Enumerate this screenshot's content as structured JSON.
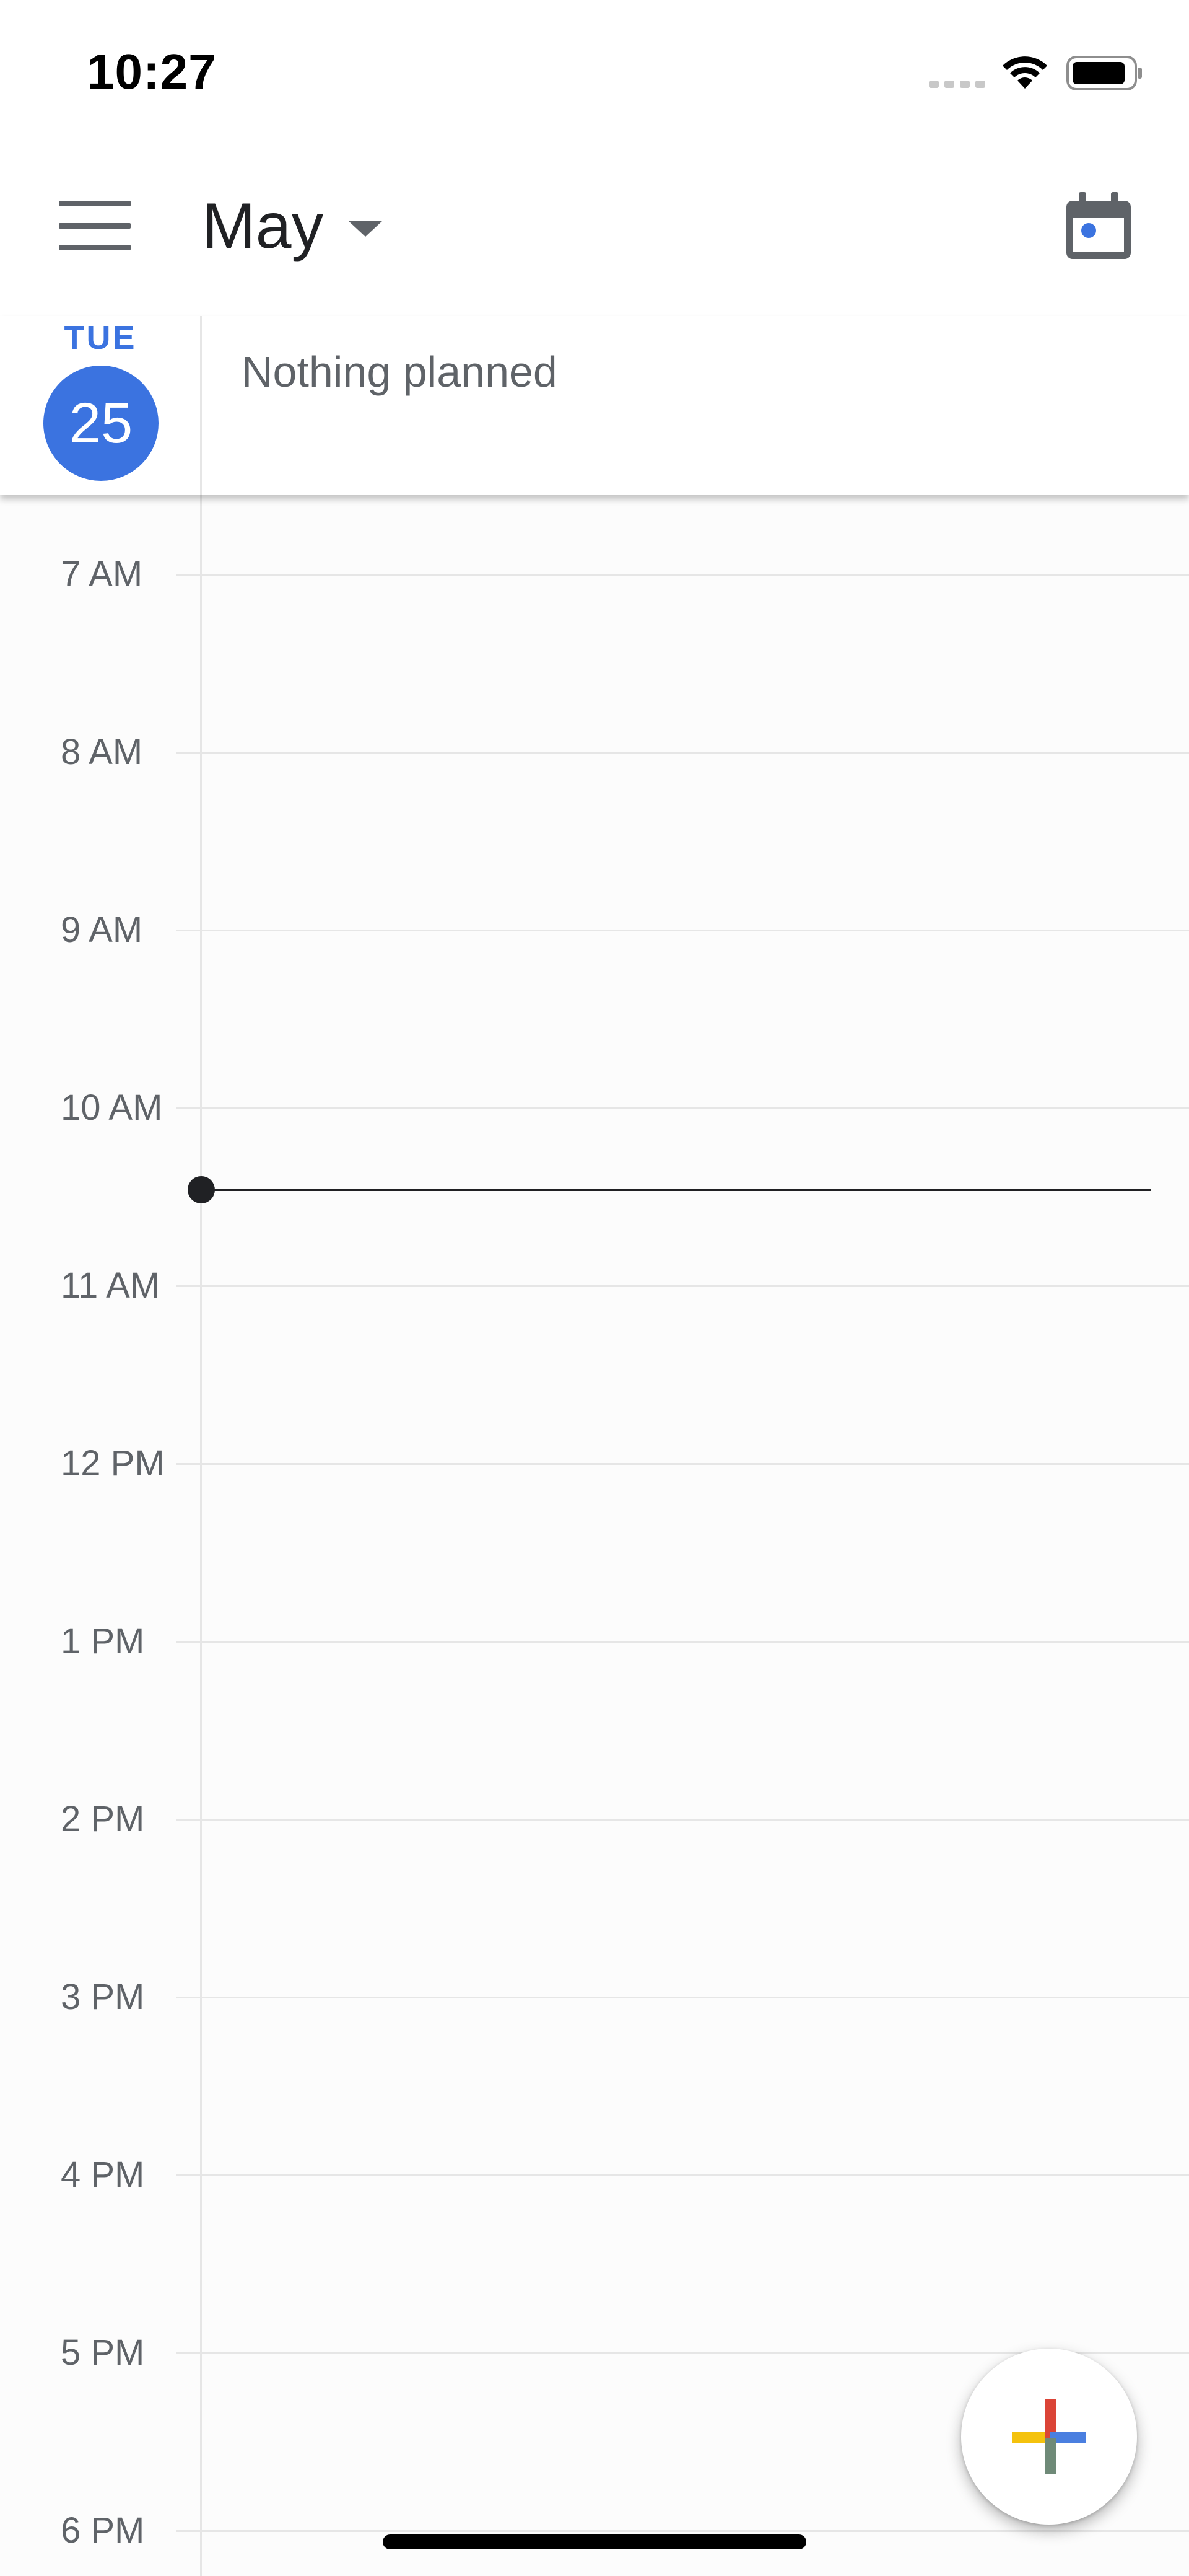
{
  "status_bar": {
    "time": "10:27",
    "icons": [
      "signal-icon",
      "wifi-icon",
      "battery-icon"
    ]
  },
  "header": {
    "menu_icon": "hamburger-menu-icon",
    "month": "May",
    "dropdown_icon": "chevron-down-icon",
    "today_icon": "calendar-today-icon"
  },
  "day": {
    "weekday": "TUE",
    "date": "25",
    "all_day_text": "Nothing planned"
  },
  "timeline": {
    "hours": [
      "7 AM",
      "8 AM",
      "9 AM",
      "10 AM",
      "11 AM",
      "12 PM",
      "1 PM",
      "2 PM",
      "3 PM",
      "4 PM",
      "5 PM",
      "6 PM"
    ],
    "current_time_indicator": "10:27"
  },
  "fab": {
    "icon": "multicolor-plus-icon"
  },
  "colors": {
    "accent_blue": "#3b73e0",
    "text_primary": "#202124",
    "text_secondary": "#5f6368",
    "grid_line": "#e6e6e6",
    "plus_red": "#db4437",
    "plus_blue": "#4a7fe0",
    "plus_yellow": "#f4c20d",
    "plus_green": "#6f8a78"
  }
}
